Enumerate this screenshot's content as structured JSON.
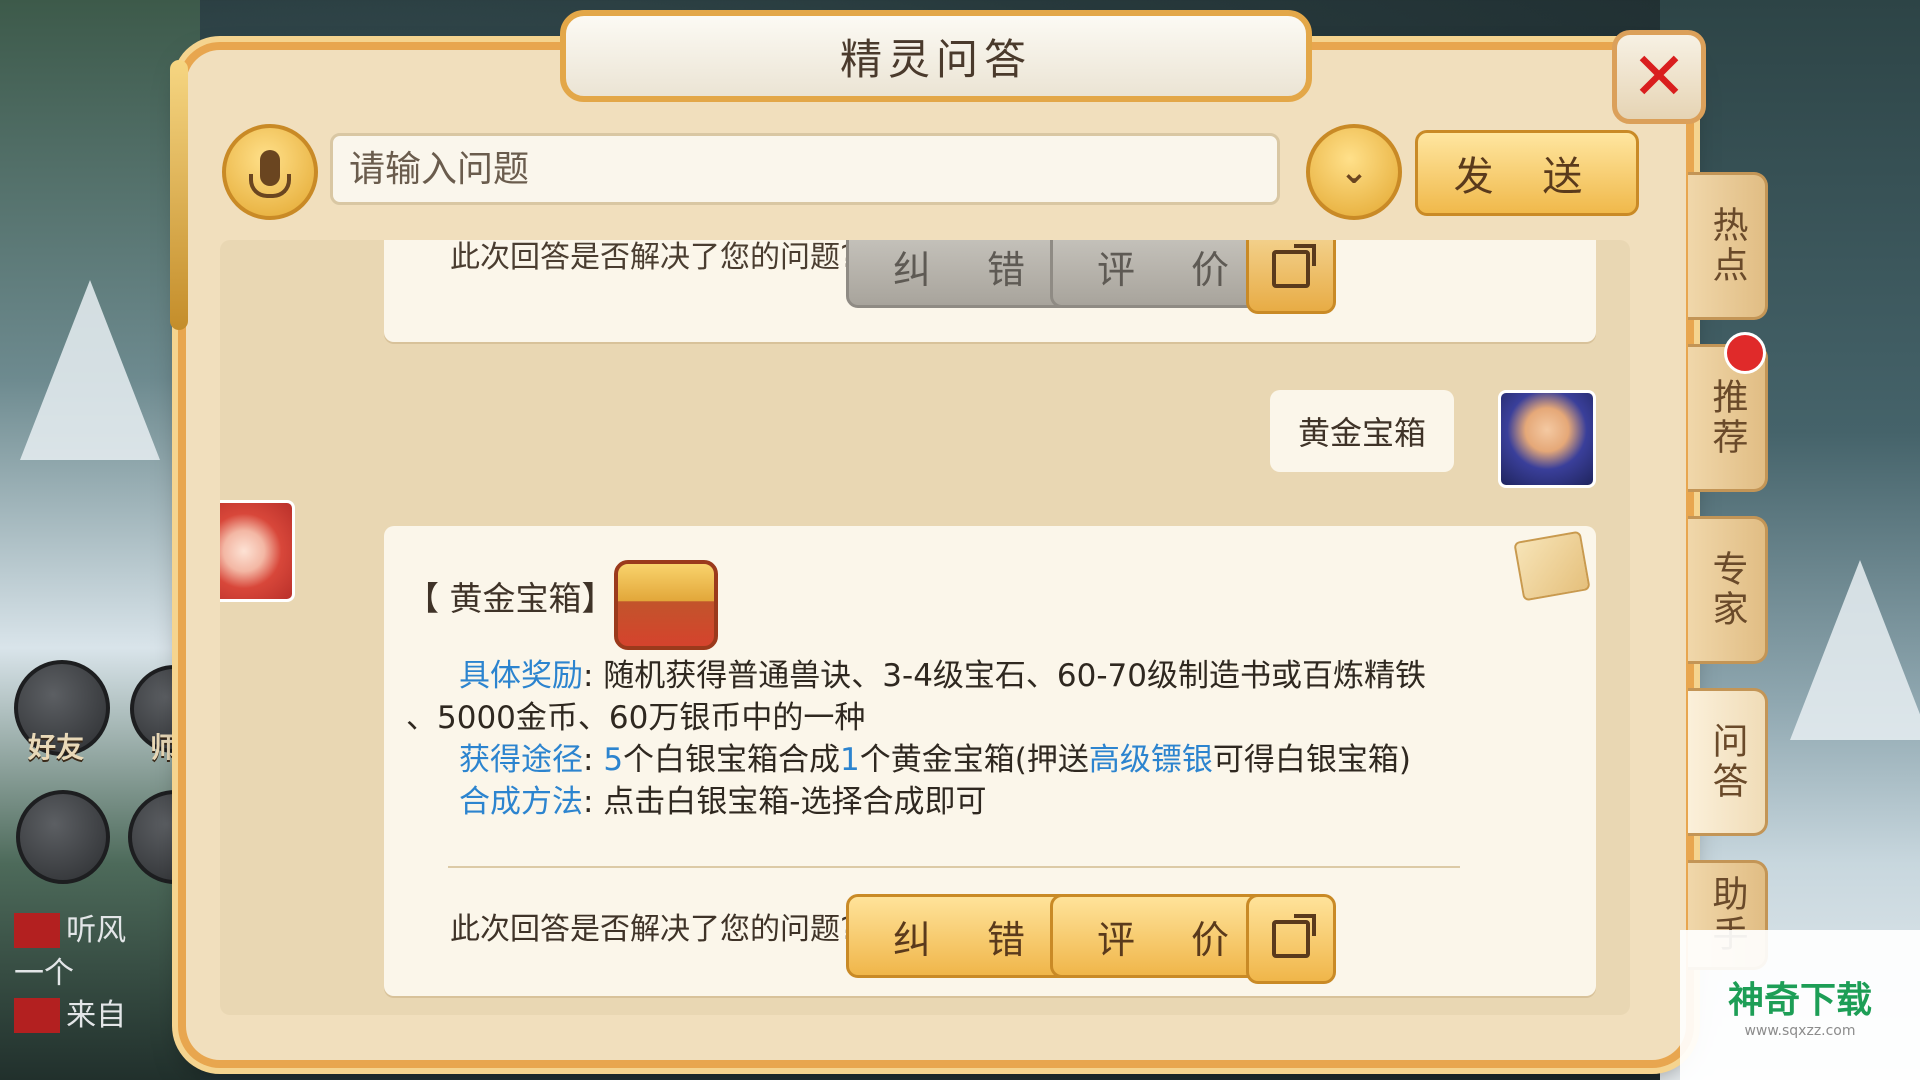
{
  "dialog": {
    "title": "精灵问答",
    "close_icon": "close-icon",
    "input_placeholder": "请输入问题",
    "send_label": "发 送"
  },
  "history": {
    "prev_question_text": "此次回答是否解决了您的问题?",
    "prev_correct_label": "纠 错",
    "prev_rate_label": "评 价"
  },
  "user_message": "黄金宝箱",
  "answer": {
    "title": "【 黄金宝箱】",
    "line1_key": "具体奖励",
    "line1_text": ": 随机获得普通兽诀、3-4级宝石、60-70级制造书或百炼精铁",
    "line2_text": "、5000金币、60万银币中的一种",
    "line3_key": "获得途径",
    "line3_a": ": ",
    "line3_num1": "5",
    "line3_b": "个白银宝箱合成",
    "line3_num2": "1",
    "line3_c": "个黄金宝箱(押送",
    "line3_link": "高级镖银",
    "line3_d": "可得白银宝箱)",
    "line4_key": "合成方法",
    "line4_text": ": 点击白银宝箱-选择合成即可",
    "question_text": "此次回答是否解决了您的问题?",
    "correct_label": "纠 错",
    "rate_label": "评 价"
  },
  "side_tabs": [
    "热点",
    "推荐",
    "专家",
    "问答",
    "助手"
  ],
  "hud": {
    "friends_label": "好友",
    "master_label": "师",
    "chat_lines": [
      {
        "tag": "",
        "text": "听风"
      },
      {
        "tag": "",
        "text": "一个"
      },
      {
        "tag": "",
        "text": "来自"
      }
    ]
  },
  "watermark": {
    "main": "神奇下载",
    "sub": "www.sqxzz.com"
  },
  "colors": {
    "frame_gold": "#e8a64f",
    "panel_bg": "#f1dfbd",
    "accent_blue": "#2c84cf",
    "close_red": "#d91e1e"
  }
}
